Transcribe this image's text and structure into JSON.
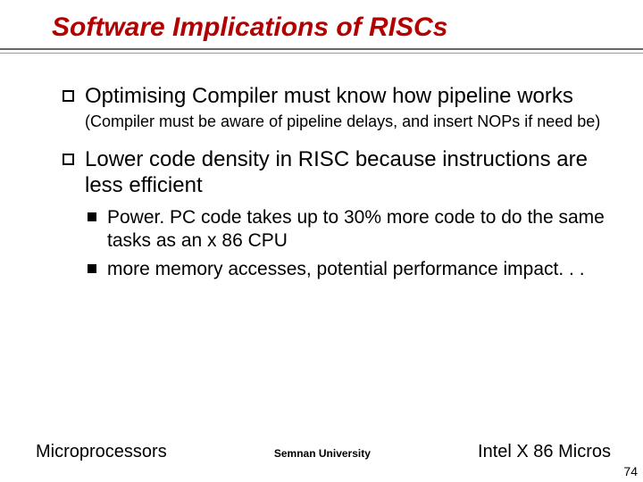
{
  "title": "Software Implications of RISCs",
  "bullets": [
    {
      "text": "Optimising Compiler must know how pipeline works",
      "note": "(Compiler must be aware of pipeline delays, and insert NOPs if need be)"
    },
    {
      "text": "Lower code density in RISC because instructions are less efficient",
      "sub": [
        "Power. PC code takes up to 30% more code to do the same tasks as an x 86 CPU",
        "more memory accesses, potential performance impact. . ."
      ]
    }
  ],
  "footer": {
    "left": "Microprocessors",
    "center": "Semnan University",
    "right": "Intel X 86 Micros"
  },
  "page_number": "74"
}
